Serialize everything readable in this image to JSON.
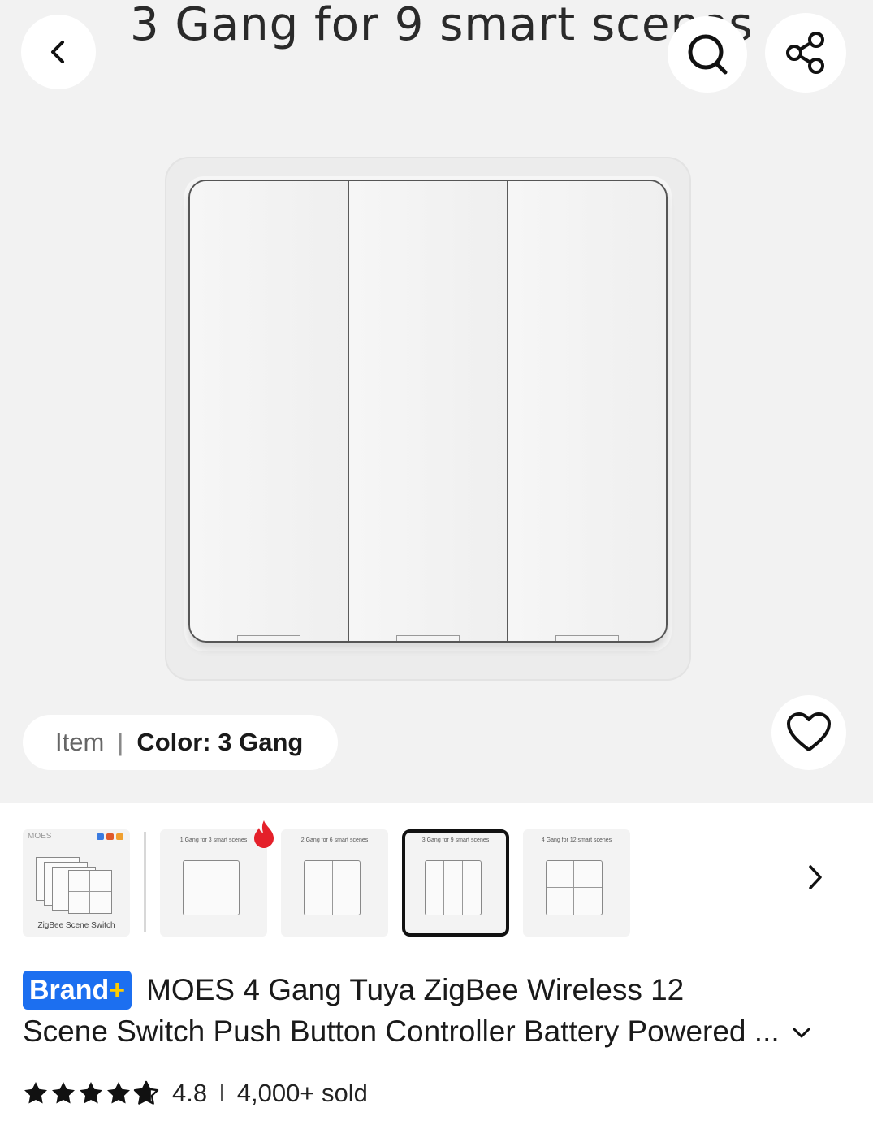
{
  "hero": {
    "caption": "3 Gang for 9 smart scenes",
    "chip": {
      "item_label": "Item",
      "separator": "|",
      "value": "Color: 3 Gang"
    }
  },
  "header": {
    "back_icon": "chevron-left-icon",
    "search_icon": "search-icon",
    "share_icon": "share-icon",
    "favorite_icon": "heart-icon"
  },
  "thumbnails": [
    {
      "caption": "ZigBee Scene Switch",
      "logo": "MOES",
      "kind": "package"
    },
    {
      "caption": "1 Gang for 3 smart scenes",
      "gangs": 1,
      "hot": true
    },
    {
      "caption": "2 Gang for 6 smart scenes",
      "gangs": 2
    },
    {
      "caption": "3 Gang for 9 smart scenes",
      "gangs": 3,
      "selected": true
    },
    {
      "caption": "4 Gang for 12 smart scenes",
      "gangs": 4
    }
  ],
  "product": {
    "badge_main": "Brand",
    "badge_plus": "+",
    "title_line1": "MOES 4 Gang Tuya ZigBee Wireless 12",
    "title_line2": "Scene Switch Push Button Controller Battery Powered ..."
  },
  "rating": {
    "score": "4.8",
    "stars": 4.8,
    "separator": "I",
    "sold": "4,000+ sold"
  },
  "colors": {
    "brand_blue": "#1c6ff0",
    "brand_plus": "#ffcc00",
    "hot_red": "#e4202a"
  }
}
